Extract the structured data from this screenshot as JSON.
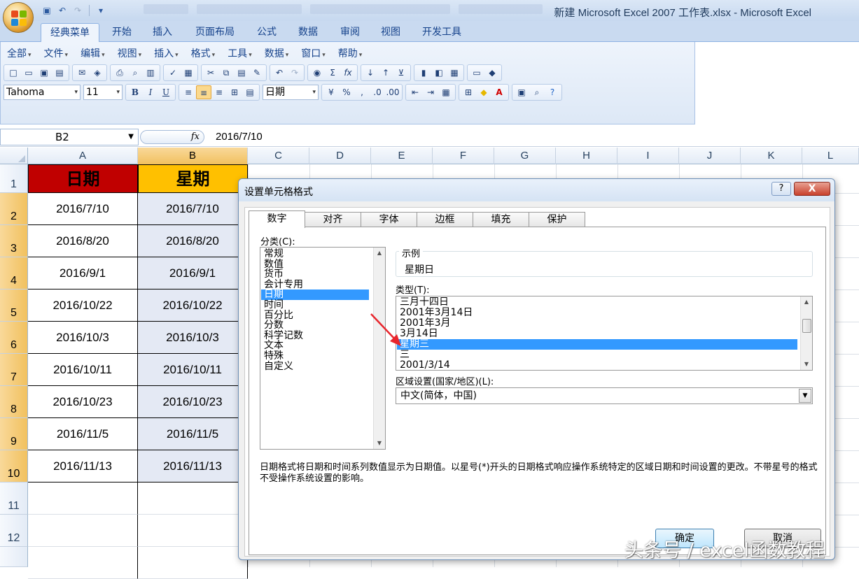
{
  "window": {
    "title": "新建 Microsoft Excel 2007 工作表.xlsx - Microsoft Excel"
  },
  "ribbon": {
    "tabs": [
      "经典菜单",
      "开始",
      "插入",
      "页面布局",
      "公式",
      "数据",
      "审阅",
      "视图",
      "开发工具"
    ],
    "active_tab": "经典菜单",
    "menus": [
      "全部",
      "文件",
      "编辑",
      "视图",
      "插入",
      "格式",
      "工具",
      "数据",
      "窗口",
      "帮助"
    ],
    "font_name": "Tahoma",
    "font_size": "11",
    "number_format": "日期"
  },
  "formula_bar": {
    "name_box": "B2",
    "fx_label": "fx",
    "formula": "2016/7/10"
  },
  "sheet": {
    "columns": [
      "A",
      "B",
      "C",
      "D",
      "E",
      "F",
      "G",
      "H",
      "I",
      "J",
      "K",
      "L"
    ],
    "selected_column": "B",
    "rows": [
      "1",
      "2",
      "3",
      "4",
      "5",
      "6",
      "7",
      "8",
      "9",
      "10",
      "11",
      "12"
    ],
    "header_a": "日期",
    "header_b": "星期",
    "header_a_color": "#c00000",
    "header_b_color": "#ffc000",
    "col_a": [
      "2016/7/10",
      "2016/8/20",
      "2016/9/1",
      "2016/10/22",
      "2016/10/3",
      "2016/10/11",
      "2016/10/23",
      "2016/11/5",
      "2016/11/13"
    ],
    "col_b": [
      "2016/7/10",
      "2016/8/20",
      "2016/9/1",
      "2016/10/22",
      "2016/10/3",
      "2016/10/11",
      "2016/10/23",
      "2016/11/5",
      "2016/11/13"
    ]
  },
  "dialog": {
    "title": "设置单元格格式",
    "help_label": "?",
    "close_label": "X",
    "tabs": [
      "数字",
      "对齐",
      "字体",
      "边框",
      "填充",
      "保护"
    ],
    "active_tab": "数字",
    "category_label": "分类(C):",
    "categories": [
      "常规",
      "数值",
      "货币",
      "会计专用",
      "日期",
      "时间",
      "百分比",
      "分数",
      "科学记数",
      "文本",
      "特殊",
      "自定义"
    ],
    "selected_category": "日期",
    "sample_label": "示例",
    "sample_value": "星期日",
    "type_label": "类型(T):",
    "types": [
      "三月十四日",
      "2001年3月14日",
      "2001年3月",
      "3月14日",
      "星期三",
      "三",
      "2001/3/14"
    ],
    "selected_type": "星期三",
    "locale_label": "区域设置(国家/地区)(L):",
    "locale_value": "中文(简体，中国)",
    "description": "日期格式将日期和时间系列数值显示为日期值。以星号(*)开头的日期格式响应操作系统特定的区域日期和时间设置的更改。不带星号的格式不受操作系统设置的影响。",
    "ok_label": "确定",
    "cancel_label": "取消"
  },
  "watermark": "头条号 / excel函数教程",
  "accent_colors": {
    "selection": "#3399ff",
    "annotation_arrow": "#e8262d"
  }
}
